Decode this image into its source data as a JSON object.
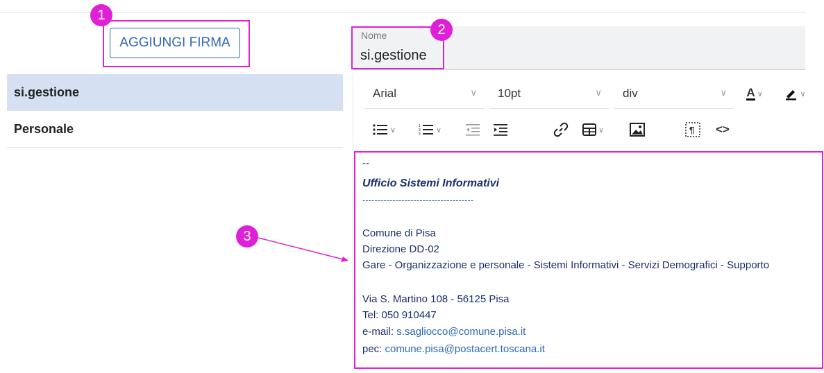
{
  "left_panel": {
    "add_button_label": "AGGIUNGI FIRMA",
    "signatures": [
      {
        "label": "si.gestione",
        "active": true
      },
      {
        "label": "Personale",
        "active": false
      }
    ]
  },
  "name_field": {
    "label": "Nome",
    "value": "si.gestione"
  },
  "toolbar": {
    "font_family": "Arial",
    "font_size": "10pt",
    "block_format": "div",
    "text_color_letter": "A"
  },
  "signature_content": {
    "dashes": "--",
    "office": "Ufficio Sistemi Informativi",
    "separator": "-------------------------------------",
    "org": "Comune di Pisa",
    "direction": "Direzione DD-02",
    "services": "Gare - Organizzazione e personale - Sistemi Informativi - Servizi Demografici - Supporto",
    "address": "Via S. Martino 108 - 56125 Pisa",
    "tel": "Tel: 050 910447",
    "email_label": "e-mail: ",
    "email": "s.sagliocco@comune.pisa.it",
    "pec_label": "pec: ",
    "pec": "comune.pisa@postacert.toscana.it"
  },
  "annotations": {
    "badge1": "1",
    "badge2": "2",
    "badge3": "3"
  },
  "colors": {
    "accent": "#2f67b8",
    "highlight": "#e020d6",
    "active_row": "#d5e1f2"
  }
}
